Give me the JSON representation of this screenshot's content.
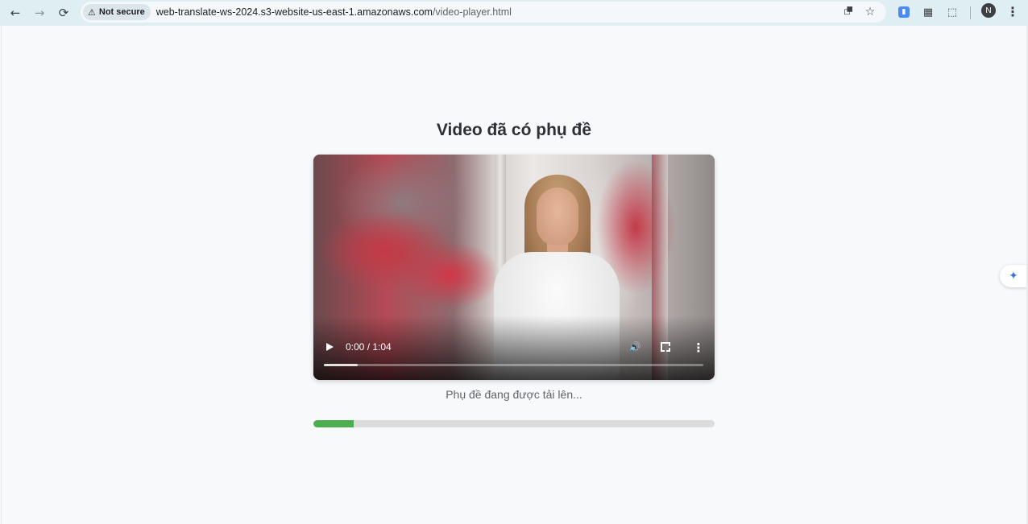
{
  "browser": {
    "back_glyph": "←",
    "forward_glyph": "→",
    "reload_glyph": "⟳",
    "security_warning_glyph": "⚠",
    "security_label": "Not secure",
    "url_host": "web-translate-ws-2024.s3-website-us-east-1.amazonaws.com",
    "url_path": "/video-player.html",
    "translate_icon_glyph": "⮻",
    "star_glyph": "☆",
    "ext_blue_glyph": "▮",
    "ext_qr_glyph": "▦",
    "ext_puzzle_glyph": "⬚",
    "profile_initial": "N",
    "menu_glyph": "⋮"
  },
  "page": {
    "title": "Video đã có phụ đề",
    "status_text": "Phụ đề đang được tải lên...",
    "upload_progress_percent": 10
  },
  "video": {
    "time_display": "0:00 / 1:04",
    "played_fraction": 0.09,
    "volume_glyph": "🔊",
    "more_glyph": "⋮"
  },
  "side_widget": {
    "glyph": "✦"
  },
  "colors": {
    "toolbar": "#dfeef3",
    "progress_fill": "#4cae50",
    "progress_track": "#dcdcdc",
    "title": "#2d3035"
  }
}
